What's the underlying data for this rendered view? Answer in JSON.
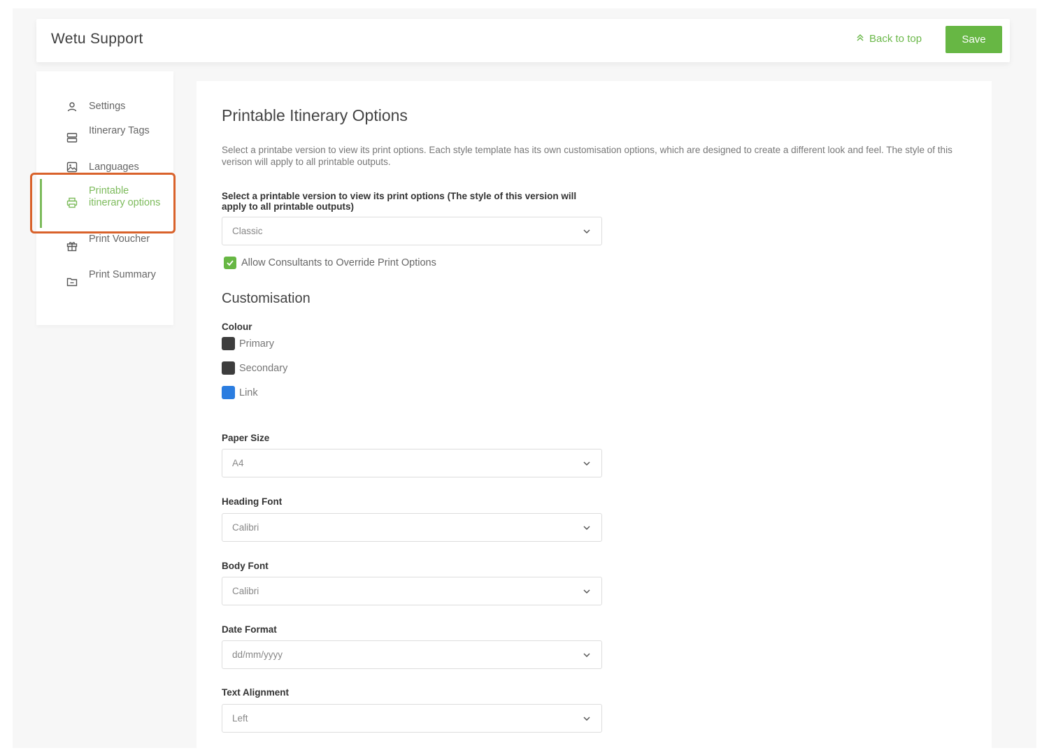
{
  "header": {
    "app_title": "Wetu Support",
    "back_to_top_label": "Back to top",
    "save_label": "Save"
  },
  "sidebar": {
    "items": [
      {
        "label": "Settings",
        "icon": "user-icon"
      },
      {
        "label": "Itinerary Tags",
        "icon": "tags-icon"
      },
      {
        "label": "Languages",
        "icon": "image-icon"
      },
      {
        "label": "Printable itinerary options",
        "icon": "printer-icon",
        "active": true
      },
      {
        "label": "Print Voucher",
        "icon": "gift-icon"
      },
      {
        "label": "Print Summary",
        "icon": "folder-icon"
      }
    ]
  },
  "main": {
    "title": "Printable Itinerary Options",
    "description": "Select a printabe version to view its print options. Each style template has its own customisation options, which are designed to create a different look and feel. The style of this verison will apply to all printable outputs.",
    "version_label": "Select a printable version to view its print options (The style of this version will apply to all printable outputs)",
    "version_value": "Classic",
    "override_label": "Allow Consultants to Override Print Options",
    "override_checked": true,
    "customisation_title": "Customisation",
    "colour_label": "Colour",
    "colours": [
      {
        "name": "Primary",
        "color": "#3d3d3d"
      },
      {
        "name": "Secondary",
        "color": "#3d3d3d"
      },
      {
        "name": "Link",
        "color": "#2b7de0"
      }
    ],
    "paper_size_label": "Paper Size",
    "paper_size_value": "A4",
    "heading_font_label": "Heading Font",
    "heading_font_value": "Calibri",
    "body_font_label": "Body Font",
    "body_font_value": "Calibri",
    "date_format_label": "Date Format",
    "date_format_value": "dd/mm/yyyy",
    "text_alignment_label": "Text Alignment",
    "text_alignment_value": "Left"
  },
  "colors": {
    "accent": "#67b744",
    "highlight": "#d9622b"
  }
}
